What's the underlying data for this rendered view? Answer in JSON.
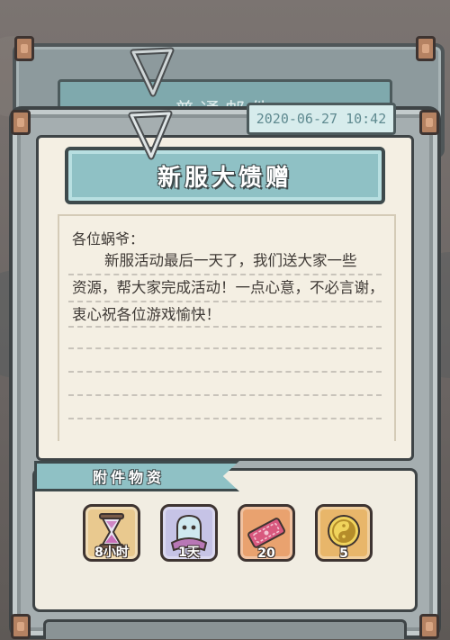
{
  "mail": {
    "rear_title": "普通邮件",
    "timestamp": "2020-06-27 10:42",
    "title": "新服大馈赠",
    "greeting": "各位蜗爷：",
    "body_lines": [
      "新服活动最后一天了，我们送大家一些",
      "资源，帮大家完成活动！一点心意，不必言谢，",
      "衷心祝各位游戏愉快！"
    ]
  },
  "attachments": {
    "header": "附件物资",
    "items": [
      {
        "icon": "hourglass-icon",
        "label": "8小时",
        "bg": "#e9c98f"
      },
      {
        "icon": "ghost-icon",
        "label": "1天",
        "bg": "#c6c3e6"
      },
      {
        "icon": "ticket-icon",
        "label": "20",
        "bg": "#e9a26f"
      },
      {
        "icon": "yin-yang-coin-icon",
        "label": "5",
        "bg": "#e8b66a"
      }
    ]
  },
  "colors": {
    "banner": "#8fc1c5",
    "paper": "#f4efe3",
    "frame": "#a5aeb0",
    "timestamp_text": "#5f8a90"
  }
}
